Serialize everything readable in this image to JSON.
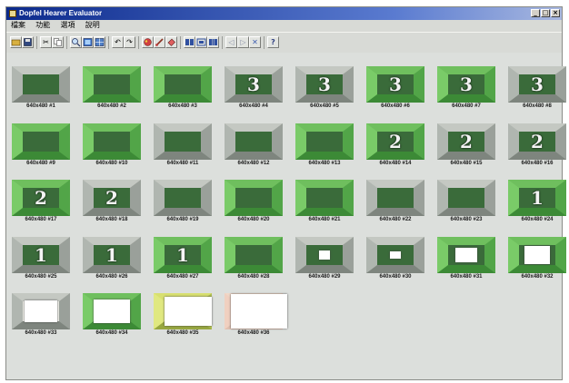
{
  "window": {
    "title": "Dopfel Hearer Evaluator"
  },
  "menu": [
    "檔案",
    "功能",
    "選項",
    "說明"
  ],
  "toolbar_icons": [
    "folder-icon",
    "save-icon",
    "cut-icon",
    "copy-icon",
    "zoom-icon",
    "view-icon",
    "grid-icon",
    "undo-icon",
    "redo-icon",
    "color-icon",
    "brush-icon",
    "fill-icon",
    "tool-a-icon",
    "tool-b-icon",
    "tool-c-icon",
    "nav-left-icon",
    "nav-right-icon",
    "close-view-icon",
    "help-icon"
  ],
  "thumbnails": [
    {
      "caption": "640x480 #1",
      "digit": ""
    },
    {
      "caption": "640x480 #2",
      "digit": ""
    },
    {
      "caption": "640x480 #3",
      "digit": ""
    },
    {
      "caption": "640x480 #4",
      "digit": "3"
    },
    {
      "caption": "640x480 #5",
      "digit": "3"
    },
    {
      "caption": "640x480 #6",
      "digit": "3"
    },
    {
      "caption": "640x480 #7",
      "digit": "3"
    },
    {
      "caption": "640x480 #8",
      "digit": "3"
    },
    {
      "caption": "640x480 #9",
      "digit": ""
    },
    {
      "caption": "640x480 #10",
      "digit": ""
    },
    {
      "caption": "640x480 #11",
      "digit": ""
    },
    {
      "caption": "640x480 #12",
      "digit": ""
    },
    {
      "caption": "640x480 #13",
      "digit": ""
    },
    {
      "caption": "640x480 #14",
      "digit": "2"
    },
    {
      "caption": "640x480 #15",
      "digit": "2"
    },
    {
      "caption": "640x480 #16",
      "digit": "2"
    },
    {
      "caption": "640x480 #17",
      "digit": "2"
    },
    {
      "caption": "640x480 #18",
      "digit": "2"
    },
    {
      "caption": "640x480 #19",
      "digit": ""
    },
    {
      "caption": "640x480 #20",
      "digit": ""
    },
    {
      "caption": "640x480 #21",
      "digit": ""
    },
    {
      "caption": "640x480 #22",
      "digit": ""
    },
    {
      "caption": "640x480 #23",
      "digit": ""
    },
    {
      "caption": "640x480 #24",
      "digit": "1"
    },
    {
      "caption": "640x480 #25",
      "digit": "1"
    },
    {
      "caption": "640x480 #26",
      "digit": "1"
    },
    {
      "caption": "640x480 #27",
      "digit": "1"
    },
    {
      "caption": "640x480 #28",
      "digit": ""
    },
    {
      "caption": "640x480 #29",
      "digit": ""
    },
    {
      "caption": "640x480 #30",
      "digit": ""
    },
    {
      "caption": "640x480 #31",
      "digit": ""
    },
    {
      "caption": "640x480 #32",
      "digit": ""
    },
    {
      "caption": "640x480 #33",
      "digit": ""
    },
    {
      "caption": "640x480 #34",
      "digit": ""
    },
    {
      "caption": "640x480 #35",
      "digit": ""
    },
    {
      "caption": "640x480 #36",
      "digit": ""
    }
  ]
}
